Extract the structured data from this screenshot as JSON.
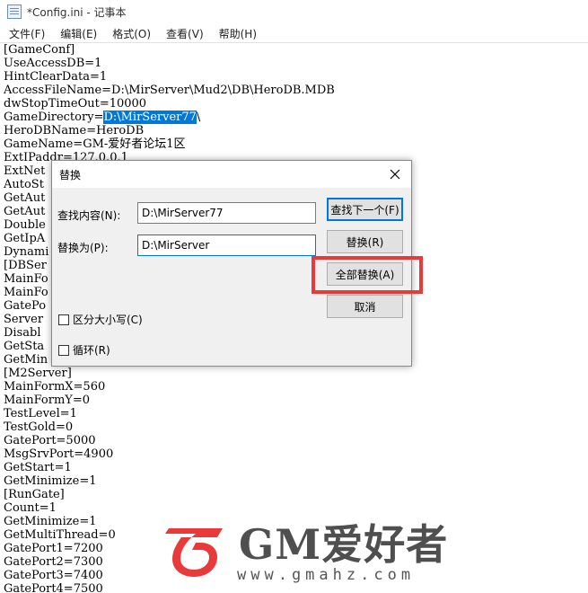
{
  "window": {
    "title": "*Config.ini - 记事本"
  },
  "menu": [
    "文件(F)",
    "编辑(E)",
    "格式(O)",
    "查看(V)",
    "帮助(H)"
  ],
  "editor": {
    "lines": [
      "[GameConf]",
      "UseAccessDB=1",
      "HintClearData=1",
      "AccessFileName=D:\\MirServer\\Mud2\\DB\\HeroDB.MDB",
      "dwStopTimeOut=10000",
      "GameDirectory=D:\\MirServer77\\",
      "HeroDBName=HeroDB",
      "GameName=GM-爱好者论坛1区",
      "ExtIPaddr=127.0.0.1",
      "ExtNet",
      "AutoSt",
      "GetAut",
      "GetAut",
      "Double",
      "GetIpA",
      "Dynami",
      "[DBSer",
      "MainFo",
      "MainFo",
      "GatePo",
      "Server",
      "Disabl",
      "GetSta",
      "GetMin",
      "[M2Server]",
      "MainFormX=560",
      "MainFormY=0",
      "TestLevel=1",
      "TestGold=0",
      "GatePort=5000",
      "MsgSrvPort=4900",
      "GetStart=1",
      "GetMinimize=1",
      "[RunGate]",
      "Count=1",
      "GetMinimize=1",
      "GetMultiThread=0",
      "GatePort1=7200",
      "GatePort2=7300",
      "GatePort3=7400",
      "GatePort4=7500"
    ],
    "selection": {
      "prefix": "GameDirectory=",
      "selected": "D:\\MirServer77",
      "suffix": "\\"
    }
  },
  "dialog": {
    "title": "替换",
    "find_label": "查找内容(N):",
    "find_value": "D:\\MirServer77",
    "replace_label": "替换为(P):",
    "replace_value": "D:\\MirServer",
    "find_next_button": "查找下一个(F)",
    "replace_button": "替换(R)",
    "replace_all_button": "全部替换(A)",
    "cancel_button": "取消",
    "match_case_label": "区分大小写(C)",
    "wrap_label": "循环(R)",
    "match_case_checked": false,
    "wrap_checked": false
  },
  "annotation": {
    "color": "#e8393b"
  },
  "watermark": {
    "brand": "GM爱好者",
    "url": "www.gmahz.com",
    "logo_color": "#e8393b"
  }
}
